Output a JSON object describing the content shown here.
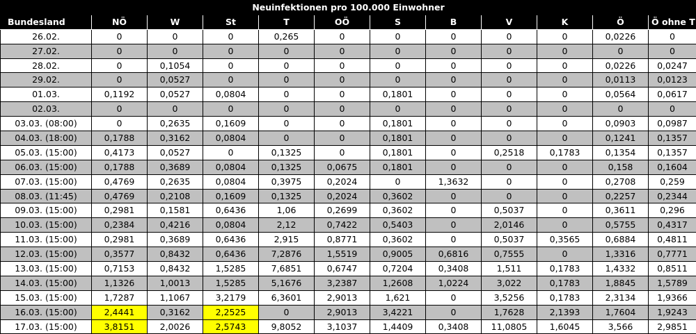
{
  "title": "Neuinfektionen pro 100.000 Einwohner",
  "columns": [
    "Bundesland",
    "NÖ",
    "W",
    "St",
    "T",
    "OÖ",
    "S",
    "B",
    "V",
    "K",
    "Ö",
    "Ö ohne T"
  ],
  "rows": [
    {
      "date": "26.02.",
      "values": [
        "0",
        "0",
        "0",
        "0,265",
        "0",
        "0",
        "0",
        "0",
        "0",
        "0,0226",
        "0"
      ]
    },
    {
      "date": "27.02.",
      "values": [
        "0",
        "0",
        "0",
        "0",
        "0",
        "0",
        "0",
        "0",
        "0",
        "0",
        "0"
      ]
    },
    {
      "date": "28.02.",
      "values": [
        "0",
        "0,1054",
        "0",
        "0",
        "0",
        "0",
        "0",
        "0",
        "0",
        "0,0226",
        "0,0247"
      ]
    },
    {
      "date": "29.02.",
      "values": [
        "0",
        "0,0527",
        "0",
        "0",
        "0",
        "0",
        "0",
        "0",
        "0",
        "0,0113",
        "0,0123"
      ]
    },
    {
      "date": "01.03.",
      "values": [
        "0,1192",
        "0,0527",
        "0,0804",
        "0",
        "0",
        "0,1801",
        "0",
        "0",
        "0",
        "0,0564",
        "0,0617"
      ]
    },
    {
      "date": "02.03.",
      "values": [
        "0",
        "0",
        "0",
        "0",
        "0",
        "0",
        "0",
        "0",
        "0",
        "0",
        "0"
      ]
    },
    {
      "date": "03.03. (08:00)",
      "values": [
        "0",
        "0,2635",
        "0,1609",
        "0",
        "0",
        "0,1801",
        "0",
        "0",
        "0",
        "0,0903",
        "0,0987"
      ]
    },
    {
      "date": "04.03. (18:00)",
      "values": [
        "0,1788",
        "0,3162",
        "0,0804",
        "0",
        "0",
        "0,1801",
        "0",
        "0",
        "0",
        "0,1241",
        "0,1357"
      ]
    },
    {
      "date": "05.03. (15:00)",
      "values": [
        "0,4173",
        "0,0527",
        "0",
        "0,1325",
        "0",
        "0,1801",
        "0",
        "0,2518",
        "0,1783",
        "0,1354",
        "0,1357"
      ]
    },
    {
      "date": "06.03. (15:00)",
      "values": [
        "0,1788",
        "0,3689",
        "0,0804",
        "0,1325",
        "0,0675",
        "0,1801",
        "0",
        "0",
        "0",
        "0,158",
        "0,1604"
      ]
    },
    {
      "date": "07.03. (15:00)",
      "values": [
        "0,4769",
        "0,2635",
        "0,0804",
        "0,3975",
        "0,2024",
        "0",
        "1,3632",
        "0",
        "0",
        "0,2708",
        "0,259"
      ]
    },
    {
      "date": "08.03. (11:45)",
      "values": [
        "0,4769",
        "0,2108",
        "0,1609",
        "0,1325",
        "0,2024",
        "0,3602",
        "0",
        "0",
        "0",
        "0,2257",
        "0,2344"
      ]
    },
    {
      "date": "09.03. (15:00)",
      "values": [
        "0,2981",
        "0,1581",
        "0,6436",
        "1,06",
        "0,2699",
        "0,3602",
        "0",
        "0,5037",
        "0",
        "0,3611",
        "0,296"
      ]
    },
    {
      "date": "10.03. (15:00)",
      "values": [
        "0,2384",
        "0,4216",
        "0,0804",
        "2,12",
        "0,7422",
        "0,5403",
        "0",
        "2,0146",
        "0",
        "0,5755",
        "0,4317"
      ]
    },
    {
      "date": "11.03. (15:00)",
      "values": [
        "0,2981",
        "0,3689",
        "0,6436",
        "2,915",
        "0,8771",
        "0,3602",
        "0",
        "0,5037",
        "0,3565",
        "0,6884",
        "0,4811"
      ]
    },
    {
      "date": "12.03. (15:00)",
      "values": [
        "0,3577",
        "0,8432",
        "0,6436",
        "7,2876",
        "1,5519",
        "0,9005",
        "0,6816",
        "0,7555",
        "0",
        "1,3316",
        "0,7771"
      ]
    },
    {
      "date": "13.03. (15:00)",
      "values": [
        "0,7153",
        "0,8432",
        "1,5285",
        "7,6851",
        "0,6747",
        "0,7204",
        "0,3408",
        "1,511",
        "0,1783",
        "1,4332",
        "0,8511"
      ]
    },
    {
      "date": "14.03. (15:00)",
      "values": [
        "1,1326",
        "1,0013",
        "1,5285",
        "5,1676",
        "3,2387",
        "1,2608",
        "1,0224",
        "3,022",
        "0,1783",
        "1,8845",
        "1,5789"
      ]
    },
    {
      "date": "15.03. (15:00)",
      "values": [
        "1,7287",
        "1,1067",
        "3,2179",
        "6,3601",
        "2,9013",
        "1,621",
        "0",
        "3,5256",
        "0,1783",
        "2,3134",
        "1,9366"
      ]
    },
    {
      "date": "16.03. (15:00)",
      "values": [
        "2,4441",
        "0,3162",
        "2,2525",
        "0",
        "2,9013",
        "3,4221",
        "0",
        "1,7628",
        "2,1393",
        "1,7604",
        "1,9243"
      ]
    },
    {
      "date": "17.03. (15:00)",
      "values": [
        "3,8151",
        "2,0026",
        "2,5743",
        "9,8052",
        "3,1037",
        "1,4409",
        "0,3408",
        "11,0805",
        "1,6045",
        "3,566",
        "2,9851"
      ]
    }
  ],
  "highlighted_cells": [
    {
      "row": 19,
      "col": 1
    },
    {
      "row": 19,
      "col": 3
    },
    {
      "row": 20,
      "col": 1
    },
    {
      "row": 20,
      "col": 3
    }
  ],
  "colors": {
    "header_bg": "#000000",
    "header_text": "#ffffff",
    "shaded_row": "#c0c0c0",
    "highlight": "#ffff00"
  }
}
